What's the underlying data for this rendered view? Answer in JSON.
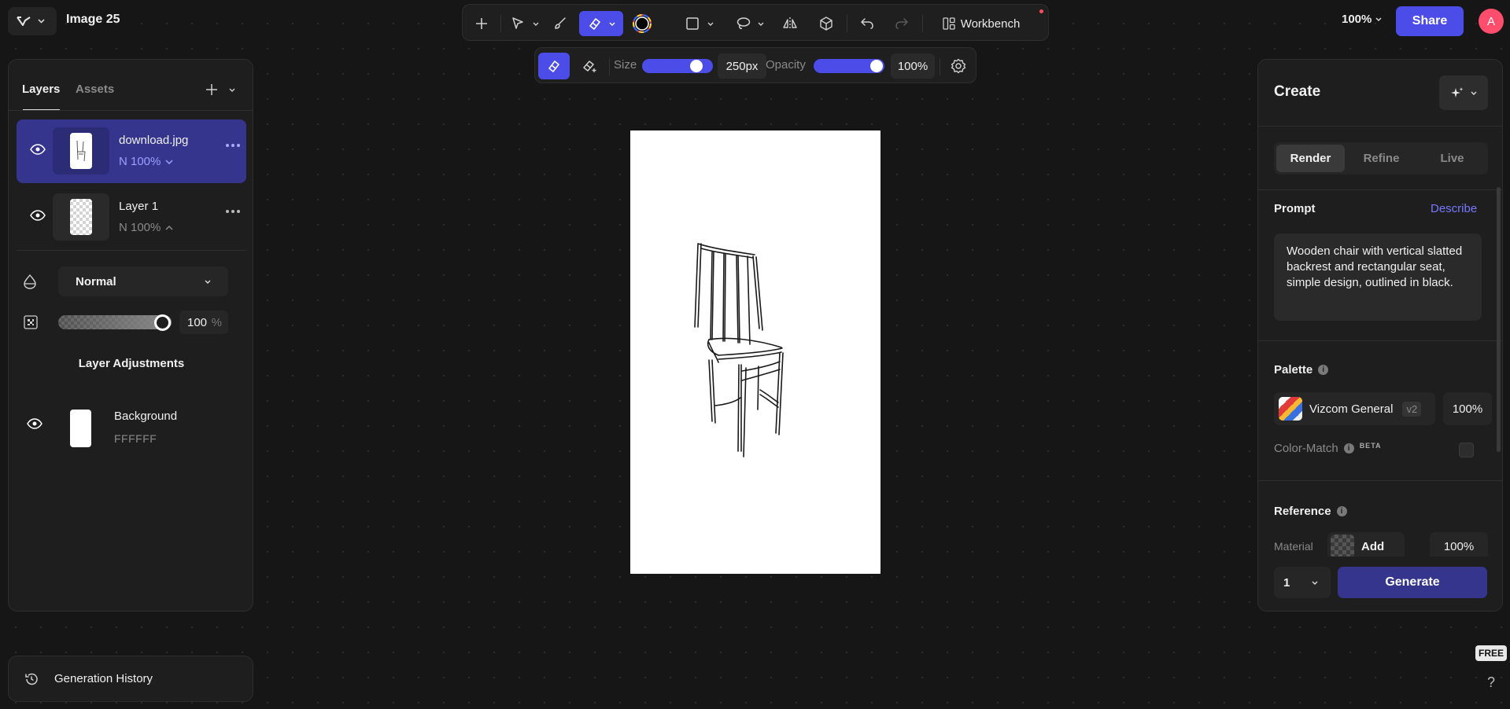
{
  "header": {
    "doc_title": "Image 25",
    "workbench_label": "Workbench",
    "zoom": "100%",
    "share_label": "Share",
    "avatar_initial": "A"
  },
  "toolbar": {
    "tools": [
      "add-icon",
      "select-arrow-icon",
      "brush-icon",
      "eraser-icon",
      "color-wheel-icon",
      "rectangle-icon",
      "lasso-icon",
      "mirror-icon",
      "3d-cube-icon",
      "undo-icon",
      "redo-icon",
      "workbench-grid-icon"
    ],
    "active_tool": "eraser"
  },
  "brush_bar": {
    "size_label": "Size",
    "size_value": "250px",
    "size_level": 0.85,
    "opacity_label": "Opacity",
    "opacity_value": "100%",
    "opacity_level": 1.0
  },
  "layers_panel": {
    "tabs": [
      "Layers",
      "Assets"
    ],
    "active_tab": "Layers",
    "layers": [
      {
        "name": "download.jpg",
        "meta": "N 100%",
        "selected": true
      },
      {
        "name": "Layer 1",
        "meta": "N 100%",
        "selected": false
      }
    ],
    "blend_mode": "Normal",
    "opacity_value": "100",
    "opacity_unit": "%",
    "adjustments_label": "Layer Adjustments",
    "background": {
      "name": "Background",
      "color": "FFFFFF"
    }
  },
  "history": {
    "label": "Generation History"
  },
  "create_panel": {
    "title": "Create",
    "modes": [
      "Render",
      "Refine",
      "Live"
    ],
    "active_mode": "Render",
    "prompt_label": "Prompt",
    "describe_label": "Describe",
    "prompt_text": "Wooden chair with vertical slatted backrest and rectangular seat, simple design, outlined in black.",
    "palette_label": "Palette",
    "palette_name": "Vizcom General",
    "palette_version": "v2",
    "palette_strength": "100%",
    "color_match_label": "Color-Match",
    "beta_label": "BETA",
    "reference_label": "Reference",
    "material_label": "Material",
    "material_button": "Add",
    "reference_strength": "100%",
    "count_value": "1",
    "generate_label": "Generate"
  },
  "badges": {
    "plan": "FREE",
    "help": "?"
  },
  "colors": {
    "accent": "#4c4de8",
    "selected_layer": "#35358e",
    "generate": "#35358e",
    "avatar": "#ff4d6d"
  }
}
